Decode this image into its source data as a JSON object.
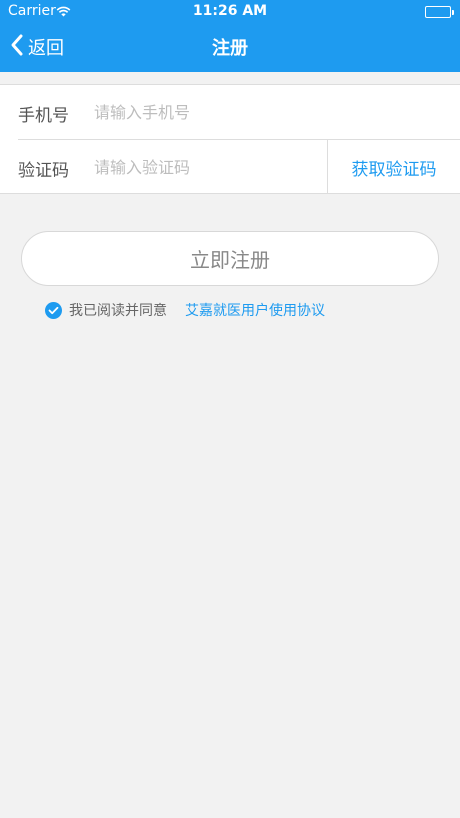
{
  "status_bar": {
    "carrier": "Carrier",
    "time": "11:26 AM"
  },
  "nav": {
    "back_label": "返回",
    "title": "注册"
  },
  "form": {
    "phone_label": "手机号",
    "phone_placeholder": "请输入手机号",
    "code_label": "验证码",
    "code_placeholder": "请输入验证码",
    "get_code_label": "获取验证码"
  },
  "register_button": "立即注册",
  "agreement": {
    "checked": true,
    "text": "我已阅读并同意",
    "link_text": "艾嘉就医用户使用协议"
  },
  "colors": {
    "brand": "#1e9bf0",
    "background": "#f2f2f2"
  },
  "icons": [
    "wifi-icon",
    "battery-icon",
    "back-chevron-icon",
    "checkmark-icon"
  ]
}
